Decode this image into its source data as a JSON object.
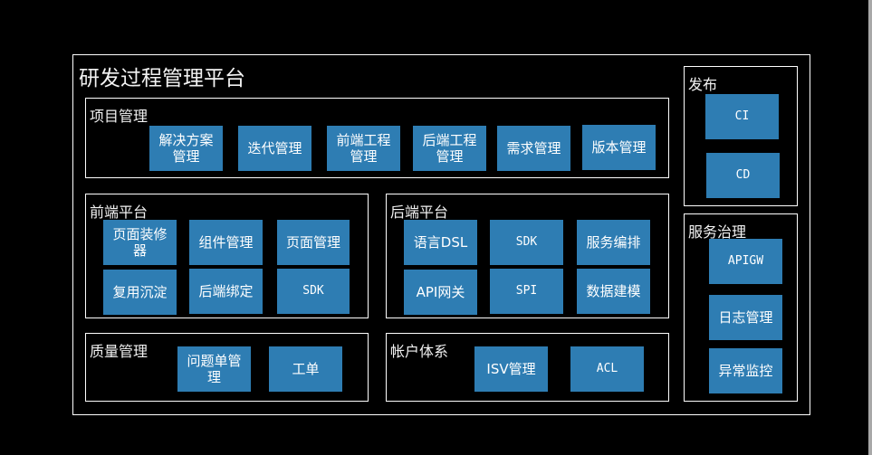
{
  "platform": {
    "title": "研发过程管理平台",
    "sections": {
      "project": {
        "title": "项目管理",
        "items": [
          "解决方案管理",
          "迭代管理",
          "前端工程管理",
          "后端工程管理",
          "需求管理",
          "版本管理"
        ]
      },
      "frontend": {
        "title": "前端平台",
        "items": [
          "页面装修器",
          "组件管理",
          "页面管理",
          "复用沉淀",
          "后端绑定",
          "SDK"
        ]
      },
      "backend": {
        "title": "后端平台",
        "items": [
          "语言DSL",
          "SDK",
          "服务编排",
          "API网关",
          "SPI",
          "数据建模"
        ]
      },
      "quality": {
        "title": "质量管理",
        "items": [
          "问题单管理",
          "工单"
        ]
      },
      "account": {
        "title": "帐户体系",
        "items": [
          "ISV管理",
          "ACL"
        ]
      },
      "release": {
        "title": "发布",
        "items": [
          "CI",
          "CD"
        ]
      },
      "governance": {
        "title": "服务治理",
        "items": [
          "APIGW",
          "日志管理",
          "异常监控"
        ]
      }
    }
  },
  "colors": {
    "background": "#000000",
    "box": "#2e7db3",
    "border": "#ffffff"
  }
}
